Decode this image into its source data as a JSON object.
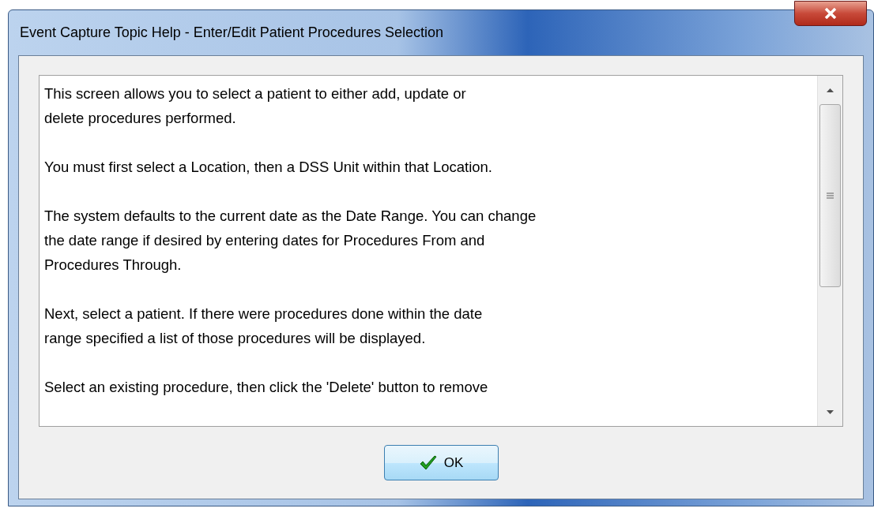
{
  "window": {
    "title": "Event Capture Topic Help - Enter/Edit Patient Procedures Selection"
  },
  "help_text": {
    "paragraphs": [
      {
        "lines": [
          "This screen allows you to select a patient to either add, update or",
          "delete procedures performed."
        ]
      },
      {
        "lines": [
          "You must first select a Location, then a DSS Unit within that Location."
        ]
      },
      {
        "lines": [
          "The system defaults to the current date as the Date Range. You can change",
          "the date range if desired by entering dates for Procedures From and",
          "Procedures Through."
        ]
      },
      {
        "lines": [
          "Next, select a patient.  If there were procedures done within the date",
          "range specified a list of those procedures will be displayed."
        ]
      },
      {
        "lines": [
          "Select an existing procedure, then click the 'Delete' button to remove"
        ]
      }
    ]
  },
  "buttons": [
    {
      "label": "OK",
      "kind": "ok"
    }
  ]
}
